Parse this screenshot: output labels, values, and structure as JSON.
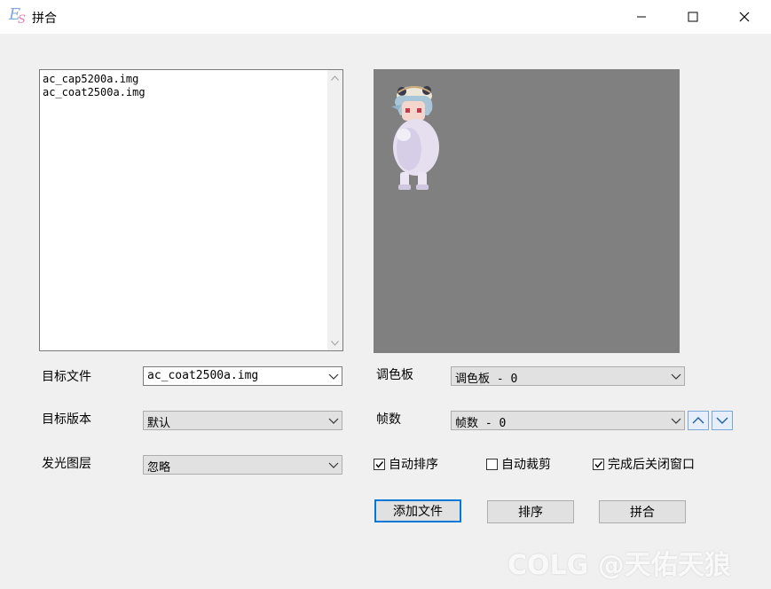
{
  "window": {
    "title": "拼合"
  },
  "file_list": {
    "items": [
      "ac_cap5200a.img",
      "ac_coat2500a.img"
    ]
  },
  "form": {
    "target_file_label": "目标文件",
    "target_file_value": "ac_coat2500a.img",
    "target_version_label": "目标版本",
    "target_version_value": "默认",
    "glow_layer_label": "发光图层",
    "glow_layer_value": "忽略",
    "palette_label": "调色板",
    "palette_value": "调色板 - 0",
    "frames_label": "帧数",
    "frames_value": "帧数 - 0"
  },
  "options": {
    "auto_sort": {
      "label": "自动排序",
      "checked": true
    },
    "auto_crop": {
      "label": "自动裁剪",
      "checked": false
    },
    "close_after": {
      "label": "完成后关闭窗口",
      "checked": true
    }
  },
  "buttons": {
    "add_file": "添加文件",
    "sort": "排序",
    "merge": "拼合"
  },
  "watermark": "COLG @天佑天狼",
  "colors": {
    "accent": "#0078d7",
    "preview_bg": "#808080"
  }
}
